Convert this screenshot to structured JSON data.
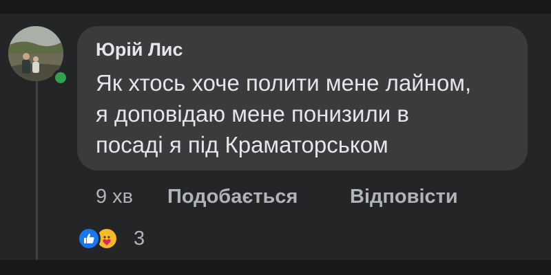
{
  "comment": {
    "author": "Юрій Лис",
    "text_lines": [
      "Як хтось хоче полити мене лайном,",
      "я доповідаю мене понизили в",
      "посаді я під Краматорськом"
    ],
    "timestamp": "9 хв",
    "online": true
  },
  "actions": {
    "like_label": "Подобається",
    "reply_label": "Відповісти"
  },
  "reactions": {
    "types": [
      "like-icon",
      "care-icon"
    ],
    "count": "3"
  },
  "colors": {
    "background": "#242526",
    "bubble": "#3a3b3c",
    "text": "#e4e6eb",
    "secondary_text": "#b0b3b8",
    "online": "#31a24c",
    "like": "#1877f2",
    "care": "#f7b928"
  }
}
